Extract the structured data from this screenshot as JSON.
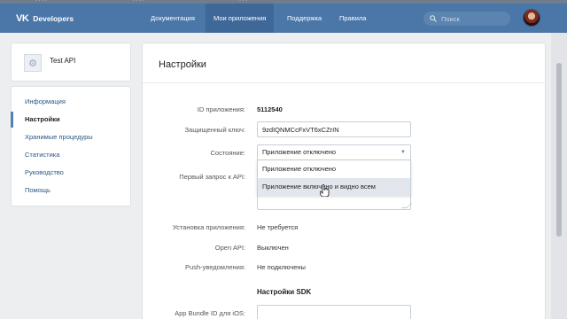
{
  "header": {
    "logo_mark": "VK",
    "logo_text": "Developers",
    "nav": [
      {
        "label": "Документация",
        "active": false
      },
      {
        "label": "Мои приложения",
        "active": true
      },
      {
        "label": "Поддержка",
        "active": false
      },
      {
        "label": "Правила",
        "active": false
      }
    ],
    "search_placeholder": "Поиск"
  },
  "sidebar": {
    "app_name": "Test API",
    "menu": [
      {
        "label": "Информация",
        "active": false
      },
      {
        "label": "Настройки",
        "active": true
      },
      {
        "label": "Хранимые процедуры",
        "active": false
      },
      {
        "label": "Статистика",
        "active": false
      },
      {
        "label": "Руководство",
        "active": false
      },
      {
        "label": "Помощь",
        "active": false
      }
    ]
  },
  "settings": {
    "title": "Настройки",
    "app_id_label": "ID приложения:",
    "app_id": "5112540",
    "secret_key_label": "Защищенный ключ:",
    "secret_key": "9zdIQNMCcFxVT6xCZrIN",
    "state_label": "Состояние:",
    "state_value": "Приложение отключено",
    "state_options": [
      "Приложение отключено",
      "Приложение включено и видно всем"
    ],
    "first_request_label": "Первый запрос к API:",
    "install_label": "Установка приложения:",
    "install_value": "Не требуется",
    "open_api_label": "Open API:",
    "open_api_value": "Выключен",
    "push_label": "Push-уведомления:",
    "push_value": "Не подключены",
    "sdk_section_title": "Настройки SDK",
    "bundle_label": "App Bundle ID для iOS:"
  },
  "colors": {
    "header_bg": "#4a76a8",
    "link": "#2a5885",
    "accent": "#5181b8",
    "page_bg": "#edeef0"
  }
}
